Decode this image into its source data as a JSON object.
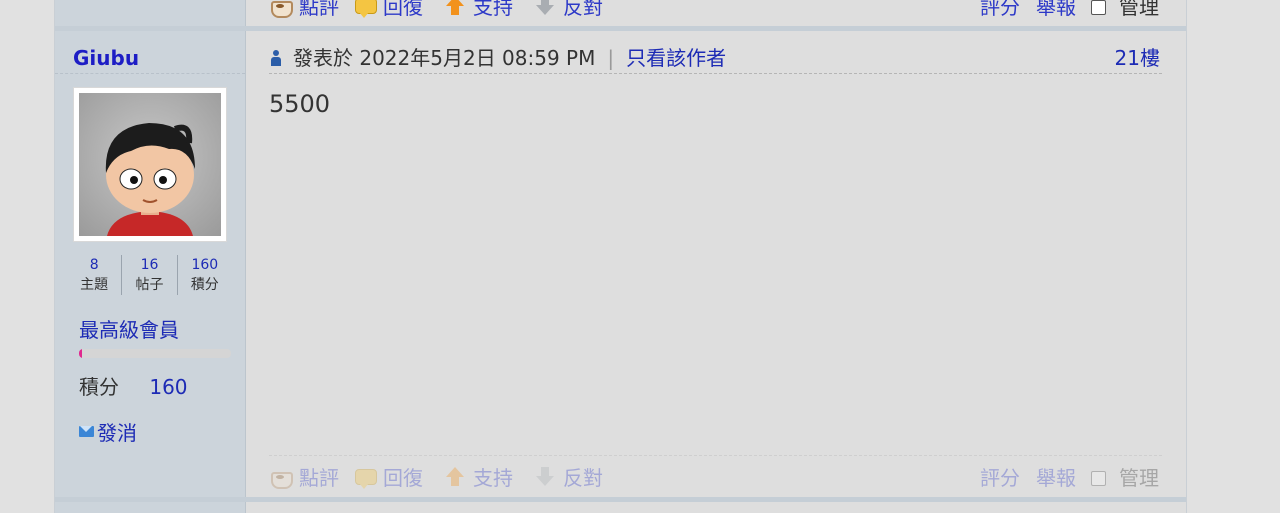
{
  "post_actions_top": {
    "comment_label": "點評",
    "reply_label": "回復",
    "support_label": "支持",
    "oppose_label": "反對",
    "rate_label": "評分",
    "report_label": "舉報",
    "manage_label": "管理"
  },
  "post_actions_bottom": {
    "comment_label": "點評",
    "reply_label": "回復",
    "support_label": "支持",
    "oppose_label": "反對",
    "rate_label": "評分",
    "report_label": "舉報",
    "manage_label": "管理"
  },
  "author": {
    "name": "Giubu",
    "stats": [
      {
        "value": "8",
        "label": "主題"
      },
      {
        "value": "16",
        "label": "帖子"
      },
      {
        "value": "160",
        "label": "積分"
      }
    ],
    "rank": "最高級會員",
    "rank_progress": 0.02,
    "credit_label": "積分",
    "credit_value": "160",
    "pm_label": "發消"
  },
  "post": {
    "posted_at": "發表於 2022年5月2日 08:59 PM",
    "separator": "|",
    "only_author_label": "只看該作者",
    "floor": "21樓",
    "content": "5500"
  },
  "colors": {
    "link": "#1d2bb5",
    "author_panel_bg": "#ccd4db",
    "rank_bar_fill": "#e0278f",
    "page_bg": "#dedede"
  }
}
